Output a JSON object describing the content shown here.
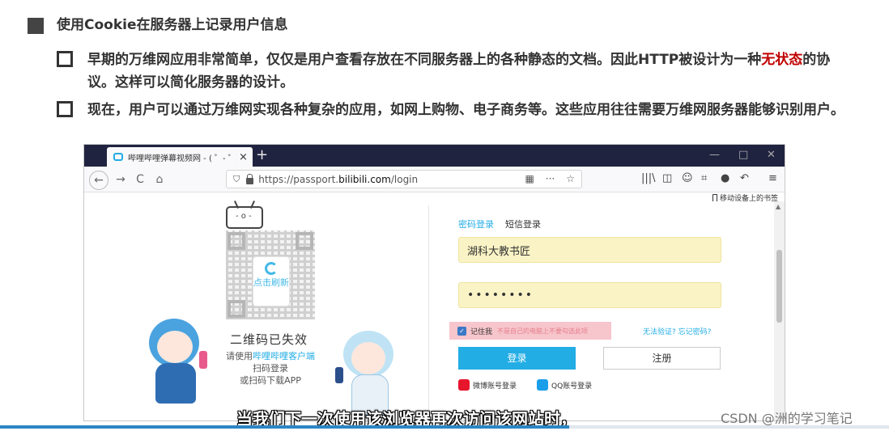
{
  "slide": {
    "top_fragment": "",
    "heading": "使用Cookie在服务器上记录用户信息",
    "bullet1_pre": "早期的万维网应用非常简单，仅仅是用户查看存放在不同服务器上的各种静态的文档。因此HTTP被设计为一种",
    "bullet1_highlight": "无状态",
    "bullet1_post": "的协议。这样可以简化服务器的设计。",
    "bullet2": "现在，用户可以通过万维网实现各种复杂的应用，如网上购物、电子商务等。这些应用往往需要万维网服务器能够识别用户。"
  },
  "browser": {
    "tab_title": "哔哩哔哩弹幕视频网 - ( ゜- ゜)",
    "tab_close": "×",
    "new_tab": "+",
    "win_minimize": "—",
    "win_maximize": "□",
    "win_close": "✕",
    "back": "←",
    "forward": "→",
    "reload": "C",
    "home": "⌂",
    "url_prefix": "https://passport.",
    "url_domain": "bilibili.com",
    "url_path": "/login",
    "url_more": "···",
    "url_star": "☆",
    "bookmarks_label": "移动设备上的书签",
    "menu": "≡"
  },
  "qr": {
    "refresh_label": "点击刷新",
    "expired_title": "二维码已失效",
    "hint_pre": "请使用",
    "hint_link": "哔哩哔哩客户端",
    "hint_line2": "扫码登录",
    "hint_line3": "或扫码下载APP"
  },
  "login": {
    "tab_password": "密码登录",
    "tab_sms": "短信登录",
    "username_value": "湖科大教书匠",
    "password_value": "••••••••",
    "remember_label": "记住我",
    "remember_hint": "不是自己的电脑上不要勾选此项",
    "links": "无法验证?  忘记密码?",
    "login_button": "登录",
    "register_button": "注册",
    "weibo_label": "微博账号登录",
    "qq_label": "QQ账号登录"
  },
  "overlay": {
    "subtitle": "当我们下一次使用该浏览器再次访问该网站时，",
    "watermark": "CSDN @洲的学习笔记",
    "video_progress_percent": 64
  },
  "colors": {
    "accent_blue": "#23ade5",
    "highlight_red": "#c00000",
    "field_yellow": "#faf3c5",
    "titlebar": "#202340"
  }
}
